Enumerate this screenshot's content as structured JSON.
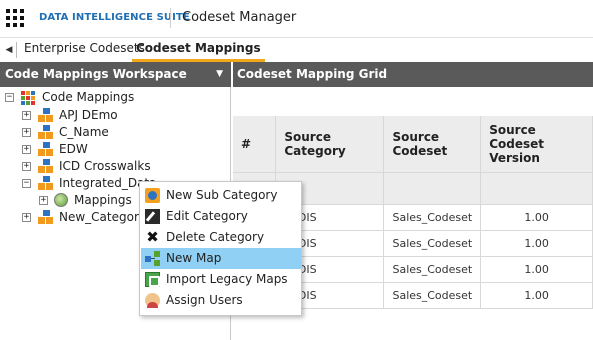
{
  "header": {
    "brand": "DATA INTELLIGENCE SUITE",
    "app_title": "Codeset Manager"
  },
  "tabs": [
    {
      "label": "Enterprise Codesets",
      "active": false
    },
    {
      "label": "Codeset Mappings",
      "active": true
    }
  ],
  "left_panel": {
    "title": "Code Mappings Workspace",
    "tree": {
      "root": "Code Mappings",
      "items": [
        {
          "label": "APJ DEmo"
        },
        {
          "label": "C_Name"
        },
        {
          "label": "EDW"
        },
        {
          "label": "ICD Crosswalks"
        },
        {
          "label": "Integrated_Data"
        },
        {
          "label": "Mappings"
        },
        {
          "label": "New_Category"
        }
      ]
    }
  },
  "right_panel": {
    "title": "Codeset Mapping Grid",
    "columns": [
      "#",
      "Source Category",
      "Source Codeset",
      "Source Codeset Version"
    ],
    "rows": [
      {
        "category": "in DIS",
        "codeset": "Sales_Codeset",
        "version": "1.00"
      },
      {
        "category": "in DIS",
        "codeset": "Sales_Codeset",
        "version": "1.00"
      },
      {
        "category": "in DIS",
        "codeset": "Sales_Codeset",
        "version": "1.00"
      },
      {
        "category": "in DIS",
        "codeset": "Sales_Codeset",
        "version": "1.00"
      }
    ]
  },
  "context_menu": {
    "items": [
      {
        "label": "New Sub Category",
        "icon": "new-sub-category-icon"
      },
      {
        "label": "Edit Category",
        "icon": "edit-icon"
      },
      {
        "label": "Delete Category",
        "icon": "delete-icon"
      },
      {
        "label": "New Map",
        "icon": "new-map-icon",
        "highlighted": true
      },
      {
        "label": "Import Legacy Maps",
        "icon": "import-icon"
      },
      {
        "label": "Assign Users",
        "icon": "user-icon"
      }
    ]
  },
  "colors": {
    "brand": "#1f6fb4",
    "panel_header": "#5a5a5a",
    "active_tab_underline": "#f3a81c",
    "menu_highlight": "#8fd0f4"
  }
}
